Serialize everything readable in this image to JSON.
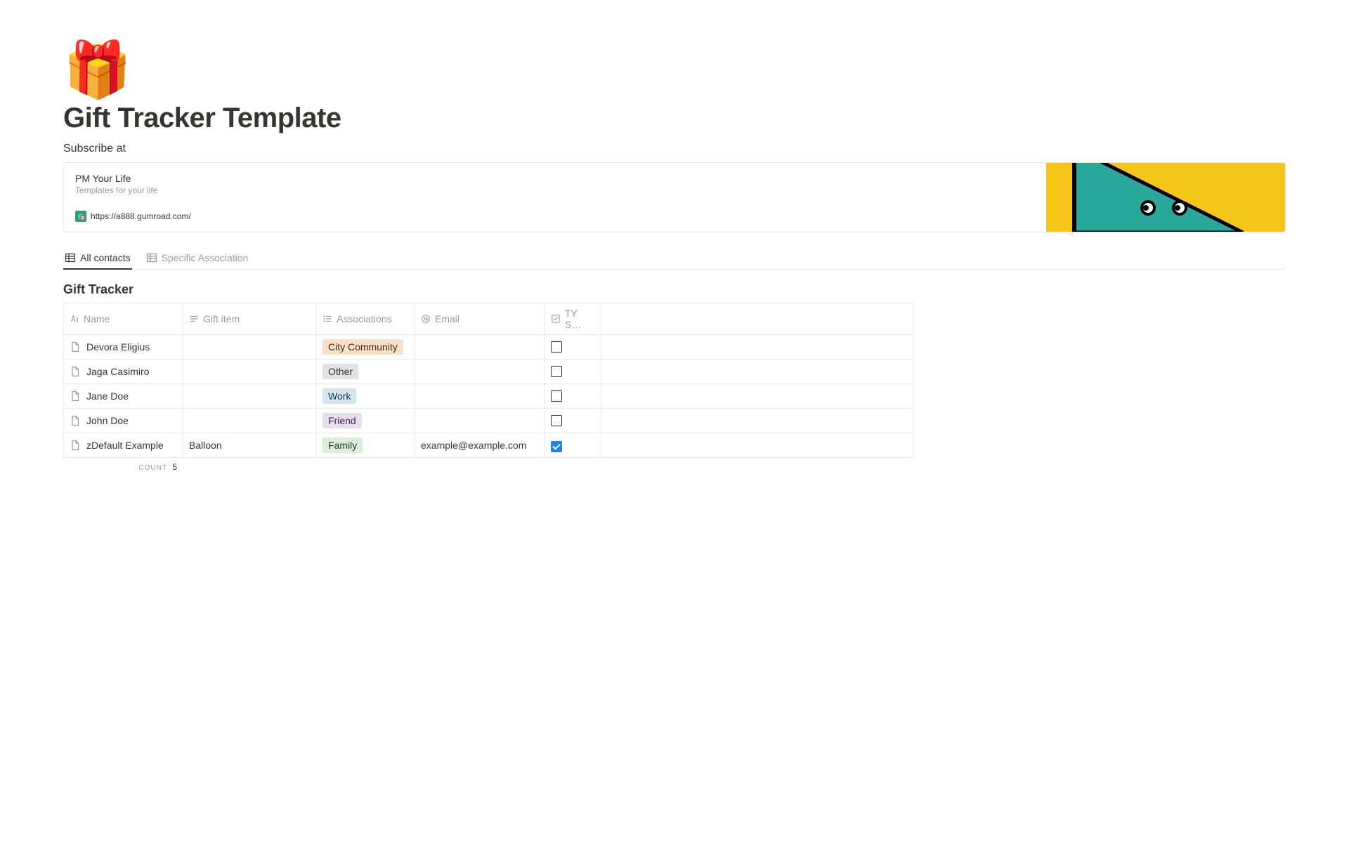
{
  "page": {
    "icon": "🎁",
    "title": "Gift Tracker Template",
    "subscribe_label": "Subscribe at"
  },
  "bookmark": {
    "title": "PM Your Life",
    "description": "Templates for your life",
    "url": "https://a888.gumroad.com/"
  },
  "tabs": [
    {
      "label": "All contacts",
      "active": true
    },
    {
      "label": "Specific Association",
      "active": false
    }
  ],
  "database": {
    "title": "Gift Tracker",
    "columns": {
      "name": "Name",
      "gift": "Gift item",
      "assoc": "Associations",
      "email": "Email",
      "ty": "TY S…"
    },
    "rows": [
      {
        "name": "Devora Eligius",
        "gift": "",
        "assoc": {
          "label": "City Community",
          "color": "orange"
        },
        "email": "",
        "ty": false
      },
      {
        "name": "Jaga Casimiro",
        "gift": "",
        "assoc": {
          "label": "Other",
          "color": "gray"
        },
        "email": "",
        "ty": false
      },
      {
        "name": "Jane Doe",
        "gift": "",
        "assoc": {
          "label": "Work",
          "color": "blue"
        },
        "email": "",
        "ty": false
      },
      {
        "name": "John Doe",
        "gift": "",
        "assoc": {
          "label": "Friend",
          "color": "purple"
        },
        "email": "",
        "ty": false
      },
      {
        "name": "zDefault Example",
        "gift": "Balloon",
        "assoc": {
          "label": "Family",
          "color": "green"
        },
        "email": "example@example.com",
        "ty": true
      }
    ],
    "count_label": "COUNT",
    "count_value": "5"
  }
}
